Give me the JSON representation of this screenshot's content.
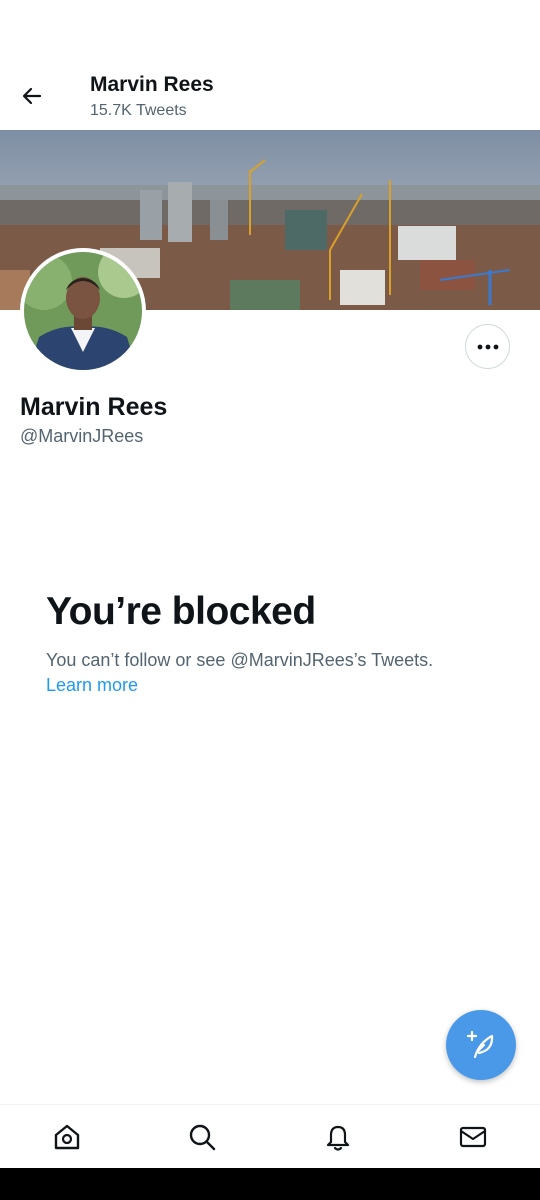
{
  "header": {
    "name": "Marvin Rees",
    "tweet_count": "15.7K Tweets",
    "back_icon": "arrow-left-icon"
  },
  "profile": {
    "name": "Marvin Rees",
    "handle": "@MarvinJRees",
    "more_icon": "more-dots-icon"
  },
  "blocked": {
    "title": "You’re blocked",
    "message": "You can’t follow or see @MarvinJRees’s Tweets.",
    "learn_more": "Learn more"
  },
  "fab": {
    "icon": "compose-tweet-icon"
  },
  "bottom_nav": {
    "items": [
      {
        "icon": "home-icon"
      },
      {
        "icon": "search-icon"
      },
      {
        "icon": "notifications-bell-icon"
      },
      {
        "icon": "messages-envelope-icon"
      }
    ]
  },
  "colors": {
    "accent": "#1d9bf0",
    "fab": "#4a99e9",
    "text_primary": "#0f1419",
    "text_secondary": "#536471"
  }
}
